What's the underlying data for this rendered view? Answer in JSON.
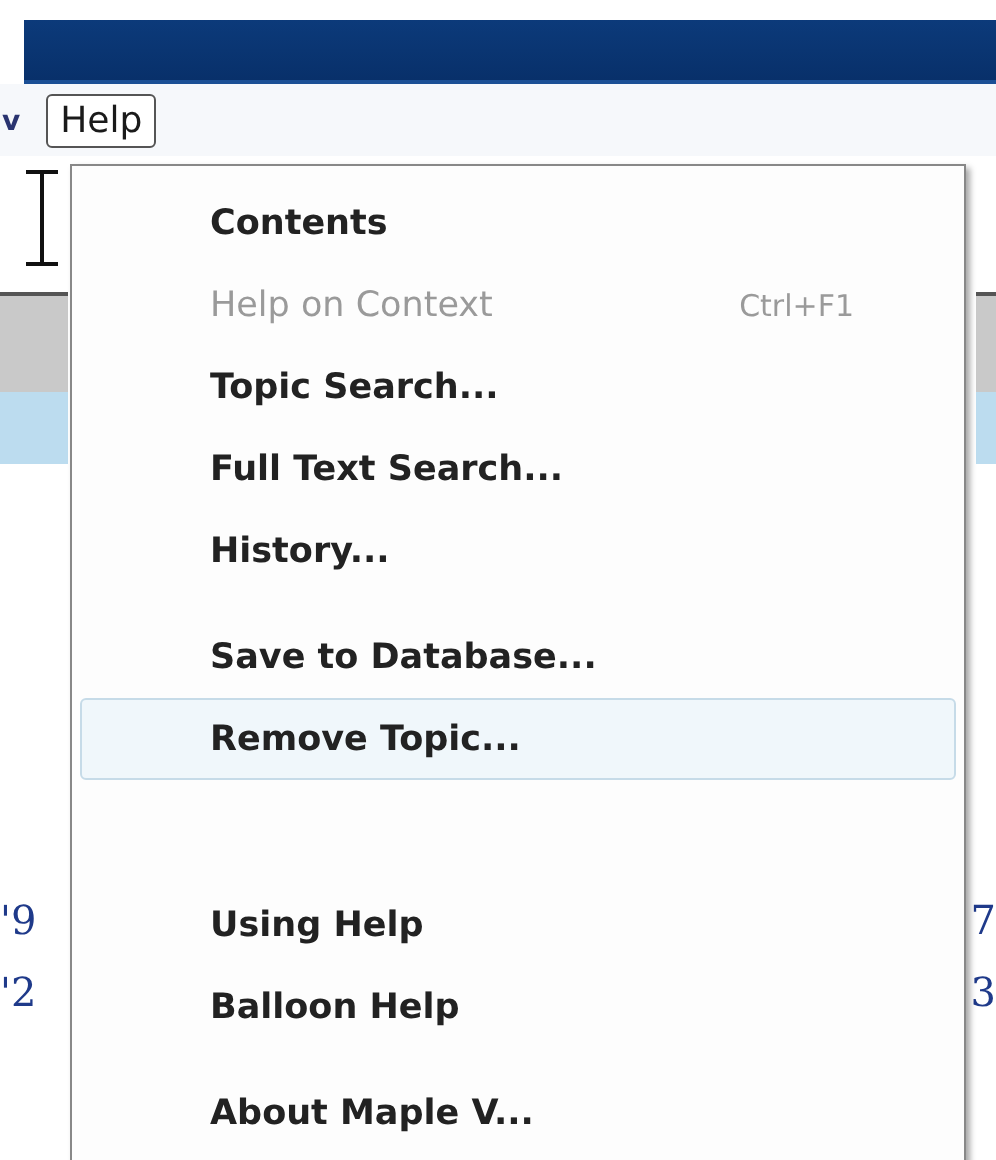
{
  "menu_bar": [
    {
      "label": "v",
      "selected": false
    },
    {
      "label": "Help",
      "selected": true
    }
  ],
  "background": {
    "left_values": [
      "'9",
      "'2"
    ],
    "right_values": [
      "7",
      "3"
    ]
  },
  "menu": {
    "items": [
      {
        "kind": "item",
        "label": "Contents",
        "disabled": false,
        "selected": false
      },
      {
        "kind": "item",
        "label": "Help on Context",
        "shortcut": "Ctrl+F1",
        "disabled": true,
        "selected": false
      },
      {
        "kind": "item",
        "label": "Topic Search...",
        "disabled": false,
        "selected": false
      },
      {
        "kind": "item",
        "label": "Full Text Search...",
        "disabled": false,
        "selected": false
      },
      {
        "kind": "item",
        "label": "History...",
        "disabled": false,
        "selected": false
      },
      {
        "kind": "separator"
      },
      {
        "kind": "item",
        "label": "Save to Database...",
        "disabled": false,
        "selected": false
      },
      {
        "kind": "item",
        "label": "Remove Topic...",
        "disabled": false,
        "selected": true
      },
      {
        "kind": "separator"
      },
      {
        "kind": "item",
        "label": "Using Help",
        "disabled": false,
        "selected": false
      },
      {
        "kind": "item",
        "label": "Balloon Help",
        "disabled": false,
        "selected": false
      },
      {
        "kind": "separator"
      },
      {
        "kind": "item",
        "label": "About Maple V...",
        "disabled": false,
        "selected": false
      }
    ]
  }
}
